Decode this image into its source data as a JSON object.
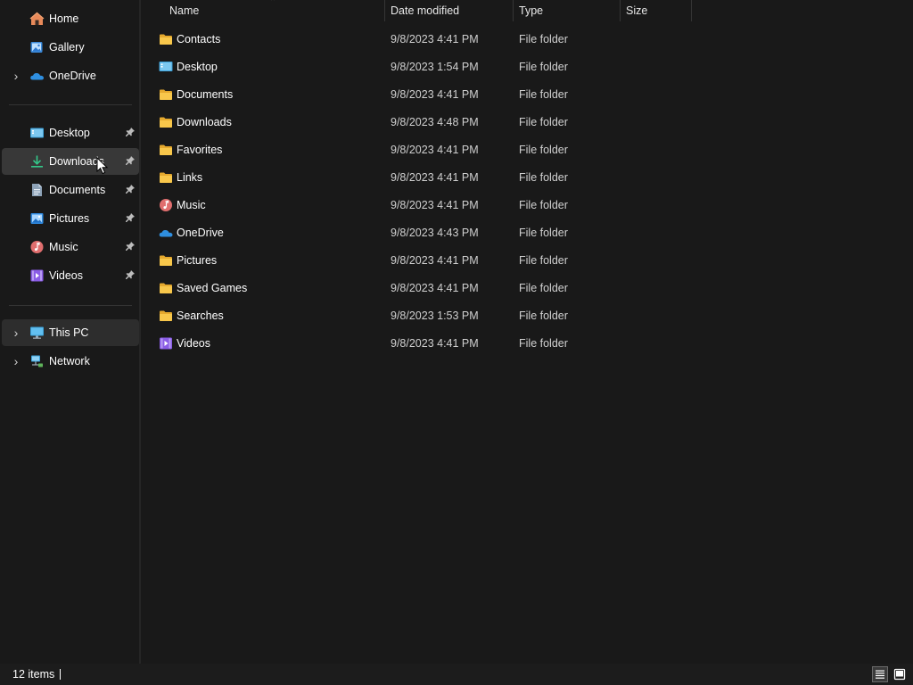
{
  "nav": {
    "top": [
      {
        "label": "Home",
        "icon": "home-icon",
        "expandable": false
      },
      {
        "label": "Gallery",
        "icon": "gallery-icon",
        "expandable": false
      },
      {
        "label": "OneDrive",
        "icon": "onedrive-icon",
        "expandable": true
      }
    ],
    "quick_access": [
      {
        "label": "Desktop",
        "icon": "desktop-icon",
        "pinned": true
      },
      {
        "label": "Downloads",
        "icon": "downloads-icon",
        "pinned": true,
        "hovered": true
      },
      {
        "label": "Documents",
        "icon": "documents-icon",
        "pinned": true
      },
      {
        "label": "Pictures",
        "icon": "pictures-icon",
        "pinned": true
      },
      {
        "label": "Music",
        "icon": "music-icon",
        "pinned": true
      },
      {
        "label": "Videos",
        "icon": "videos-icon",
        "pinned": true
      }
    ],
    "locations": [
      {
        "label": "This PC",
        "icon": "this-pc-icon",
        "expandable": true,
        "selected": true
      },
      {
        "label": "Network",
        "icon": "network-icon",
        "expandable": true
      }
    ]
  },
  "columns": {
    "name": "Name",
    "date_modified": "Date modified",
    "type": "Type",
    "size": "Size",
    "sorted_by": "Name",
    "sort_direction": "ascending"
  },
  "files": [
    {
      "name": "Contacts",
      "date": "9/8/2023 4:41 PM",
      "type": "File folder",
      "size": "",
      "icon": "folder-icon"
    },
    {
      "name": "Desktop",
      "date": "9/8/2023 1:54 PM",
      "type": "File folder",
      "size": "",
      "icon": "desktop-icon"
    },
    {
      "name": "Documents",
      "date": "9/8/2023 4:41 PM",
      "type": "File folder",
      "size": "",
      "icon": "folder-icon"
    },
    {
      "name": "Downloads",
      "date": "9/8/2023 4:48 PM",
      "type": "File folder",
      "size": "",
      "icon": "folder-icon"
    },
    {
      "name": "Favorites",
      "date": "9/8/2023 4:41 PM",
      "type": "File folder",
      "size": "",
      "icon": "folder-icon"
    },
    {
      "name": "Links",
      "date": "9/8/2023 4:41 PM",
      "type": "File folder",
      "size": "",
      "icon": "folder-icon"
    },
    {
      "name": "Music",
      "date": "9/8/2023 4:41 PM",
      "type": "File folder",
      "size": "",
      "icon": "music-icon"
    },
    {
      "name": "OneDrive",
      "date": "9/8/2023 4:43 PM",
      "type": "File folder",
      "size": "",
      "icon": "onedrive-icon"
    },
    {
      "name": "Pictures",
      "date": "9/8/2023 4:41 PM",
      "type": "File folder",
      "size": "",
      "icon": "folder-icon"
    },
    {
      "name": "Saved Games",
      "date": "9/8/2023 4:41 PM",
      "type": "File folder",
      "size": "",
      "icon": "folder-icon"
    },
    {
      "name": "Searches",
      "date": "9/8/2023 1:53 PM",
      "type": "File folder",
      "size": "",
      "icon": "folder-icon"
    },
    {
      "name": "Videos",
      "date": "9/8/2023 4:41 PM",
      "type": "File folder",
      "size": "",
      "icon": "videos-icon"
    }
  ],
  "status": {
    "item_count": "12 items",
    "view_modes": [
      {
        "name": "details-view-icon",
        "active": true
      },
      {
        "name": "large-icons-view-icon",
        "active": false
      }
    ]
  },
  "colors": {
    "background": "#191919",
    "selected_bg": "#383838",
    "folder_yellow": "#f8c74b",
    "onedrive_blue": "#2f8fe0",
    "music_red": "#e06e6e",
    "videos_purple": "#8a5ce6"
  }
}
